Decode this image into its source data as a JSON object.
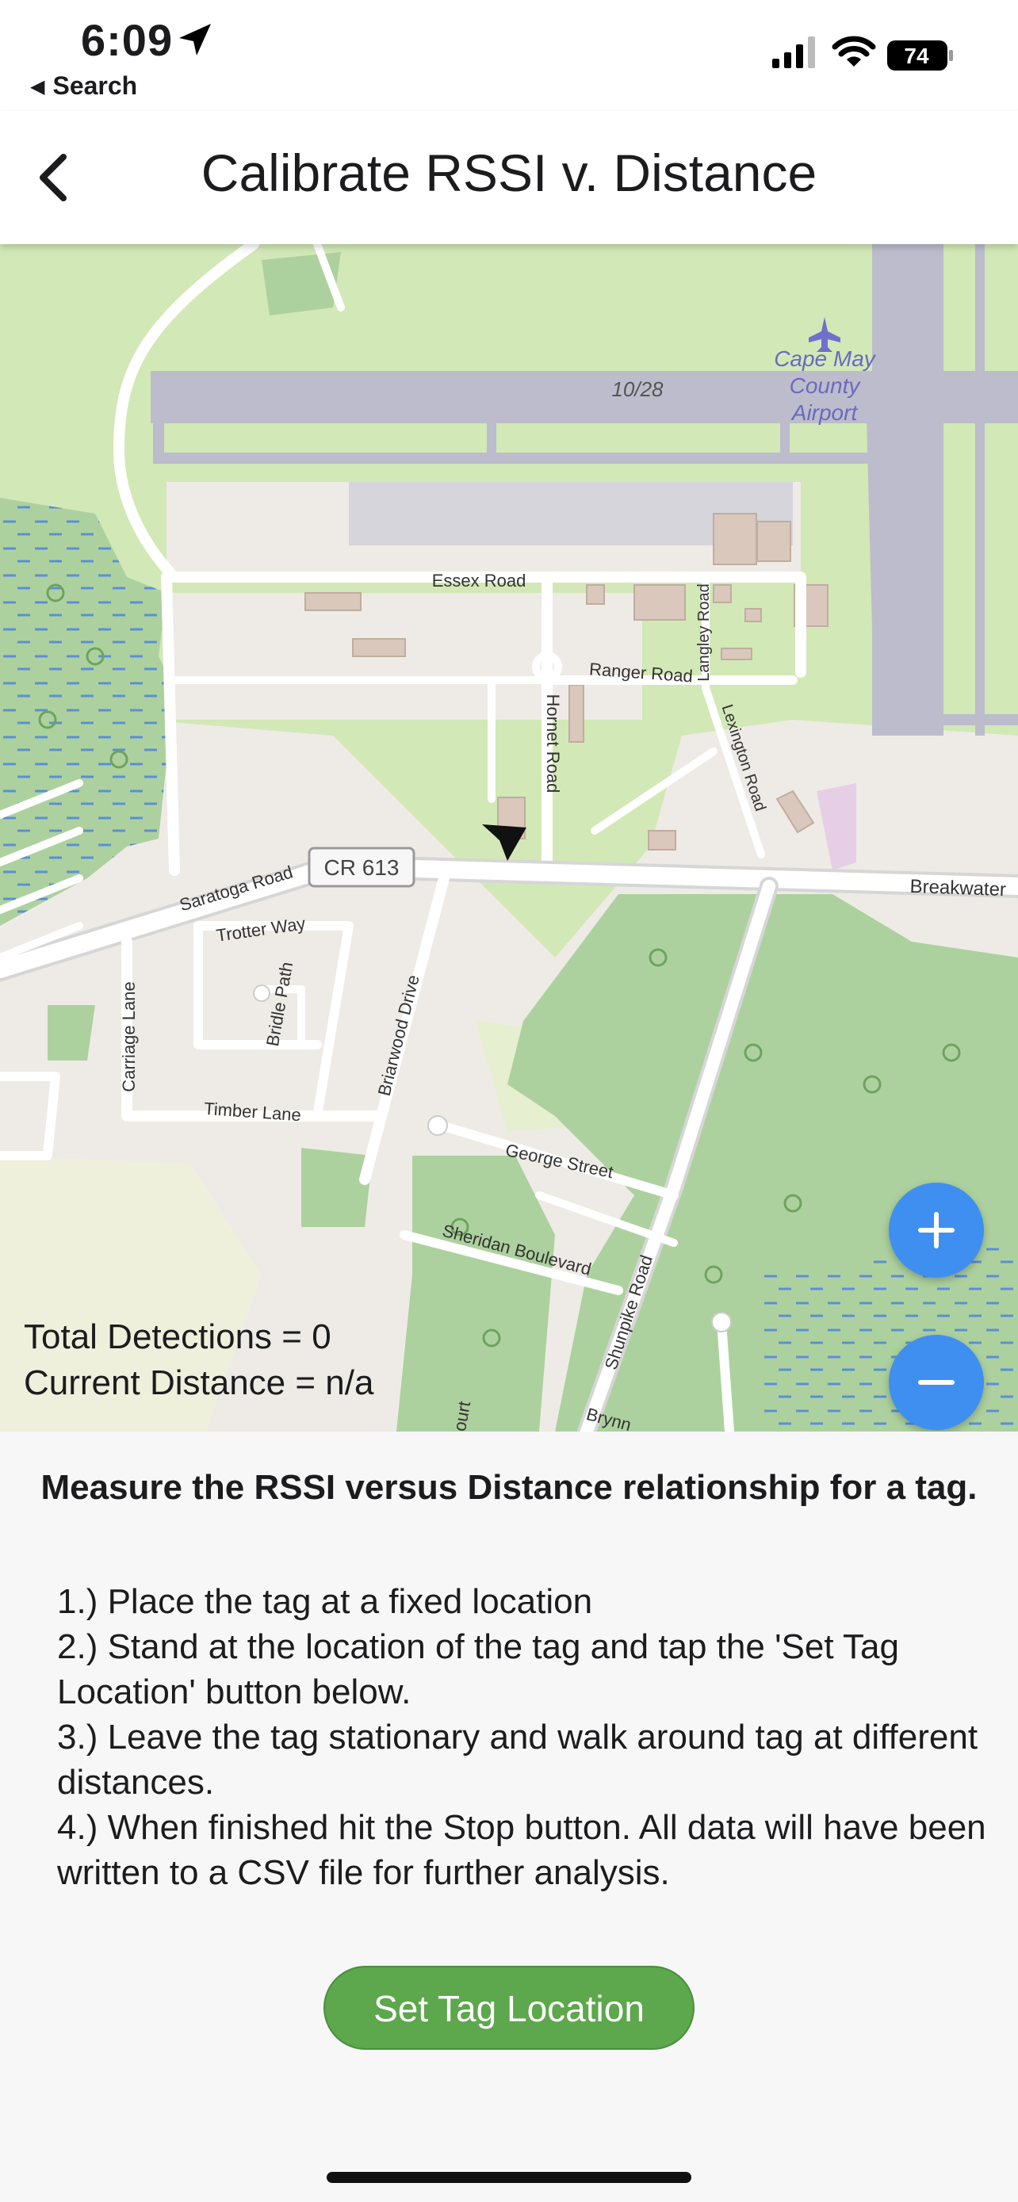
{
  "status_bar": {
    "time": "6:09",
    "back_app_label": "Search",
    "battery_level": "74",
    "icons": [
      "location-arrow-icon",
      "signal-icon",
      "wifi-icon",
      "battery-icon"
    ]
  },
  "nav": {
    "title": "Calibrate RSSI v. Distance",
    "back_icon": "chevron-left-icon"
  },
  "map": {
    "labels": {
      "airport": [
        "Cape May",
        "County",
        "Airport"
      ],
      "runway": "10/28",
      "essex": "Essex Road",
      "ranger": "Ranger Road",
      "langley": "Langley Road",
      "hornet": "Hornet Road",
      "lexington": "Lexington Road",
      "saratoga": "Saratoga Road",
      "cr613": "CR 613",
      "breakwater": "Breakwater",
      "trotter": "Trotter Way",
      "bridle": "Bridle Path",
      "carriage": "Carriage Lane",
      "briarwood": "Briarwood Drive",
      "timber": "Timber Lane",
      "george": "George Street",
      "sheridan": "Sheridan Boulevard",
      "shunpike": "Shunpike Road",
      "court": "ourt",
      "brynn": "Brynn"
    },
    "total_detections": "Total Detections = 0",
    "current_distance": "Current Distance = n/a",
    "zoom_in_label": "+",
    "zoom_out_label": "−",
    "colors": {
      "land": "#eeebe6",
      "park": "#d2e8b6",
      "wood": "#add19e",
      "wetland_dash": "#5b8fd6",
      "runway": "#bcbccc",
      "road": "#ffffff",
      "building": "#d9c8bb",
      "zoom_button": "#3f8ff1"
    }
  },
  "instructions": {
    "title": "Measure the RSSI versus Distance relationship for a tag.",
    "steps": [
      "1.) Place the tag at a fixed location",
      "2.) Stand at the location of the tag and tap the 'Set Tag Location' button below.",
      "3.) Leave the tag stationary and walk around tag at different distances.",
      "4.) When finished hit the Stop button. All data will have been written to a CSV file for further analysis."
    ],
    "button_label": "Set Tag Location",
    "button_color": "#5da74c"
  }
}
